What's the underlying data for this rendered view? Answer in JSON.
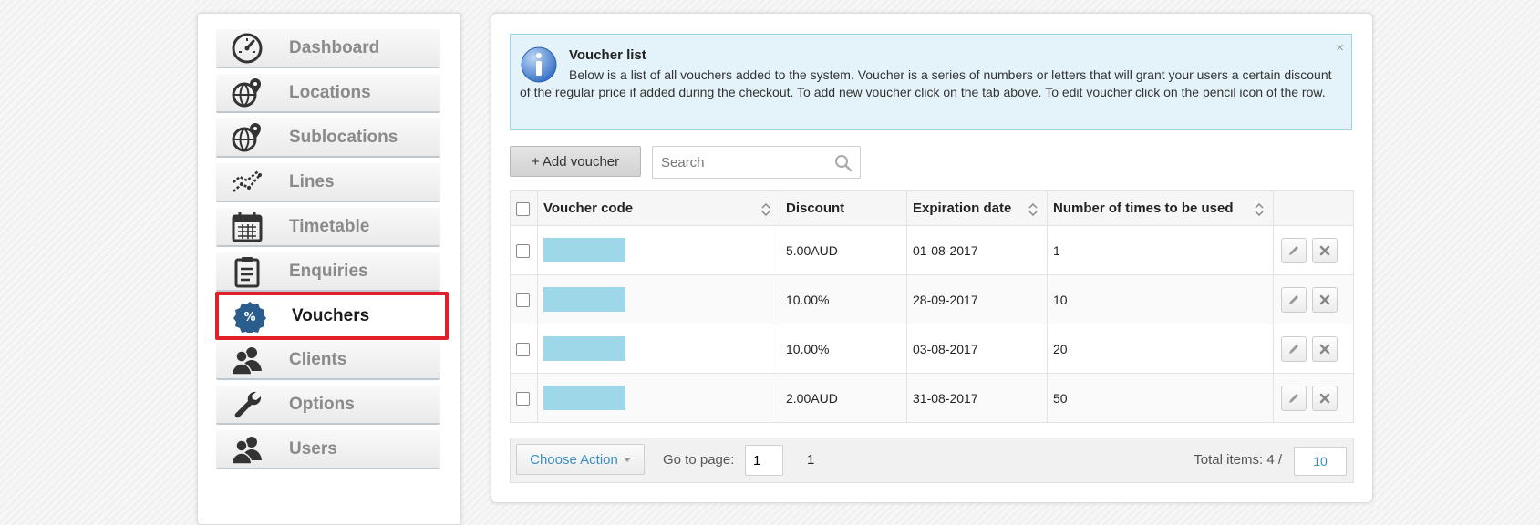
{
  "sidebar": {
    "items": [
      {
        "label": "Dashboard",
        "icon": "dashboard-gauge-icon"
      },
      {
        "label": "Locations",
        "icon": "globe-pin-icon"
      },
      {
        "label": "Sublocations",
        "icon": "globe-pin-icon"
      },
      {
        "label": "Lines",
        "icon": "line-graph-icon"
      },
      {
        "label": "Timetable",
        "icon": "calendar-icon"
      },
      {
        "label": "Enquiries",
        "icon": "clipboard-icon"
      },
      {
        "label": "Vouchers",
        "icon": "percent-badge-icon",
        "active": true
      },
      {
        "label": "Clients",
        "icon": "users-icon"
      },
      {
        "label": "Options",
        "icon": "wrench-icon"
      },
      {
        "label": "Users",
        "icon": "users-icon"
      }
    ]
  },
  "notice": {
    "title": "Voucher list",
    "body": "Below is a list of all vouchers added to the system. Voucher is a series of numbers or letters that will grant your users a certain discount of the regular price if added during the checkout. To add new voucher click on the tab above. To edit voucher click on the pencil icon of the row.",
    "close": "×"
  },
  "toolbar": {
    "add_label": "+ Add voucher",
    "search_placeholder": "Search"
  },
  "table": {
    "headers": {
      "code": "Voucher code",
      "discount": "Discount",
      "expiration": "Expiration date",
      "uses": "Number of times to be used"
    },
    "rows": [
      {
        "discount": "5.00AUD",
        "expiration": "01-08-2017",
        "uses": "1"
      },
      {
        "discount": "10.00%",
        "expiration": "28-09-2017",
        "uses": "10"
      },
      {
        "discount": "10.00%",
        "expiration": "03-08-2017",
        "uses": "20"
      },
      {
        "discount": "2.00AUD",
        "expiration": "31-08-2017",
        "uses": "50"
      }
    ]
  },
  "footer": {
    "choose_action": "Choose Action",
    "goto_label": "Go to page:",
    "goto_value": "1",
    "page_number": "1",
    "total_label": "Total items: 4 /",
    "per_page": "10"
  },
  "colors": {
    "accent": "#3a8fc4",
    "active_border": "#e0202a",
    "notice_bg": "#e4f3fa",
    "redacted_code": "#9ed8e8"
  }
}
